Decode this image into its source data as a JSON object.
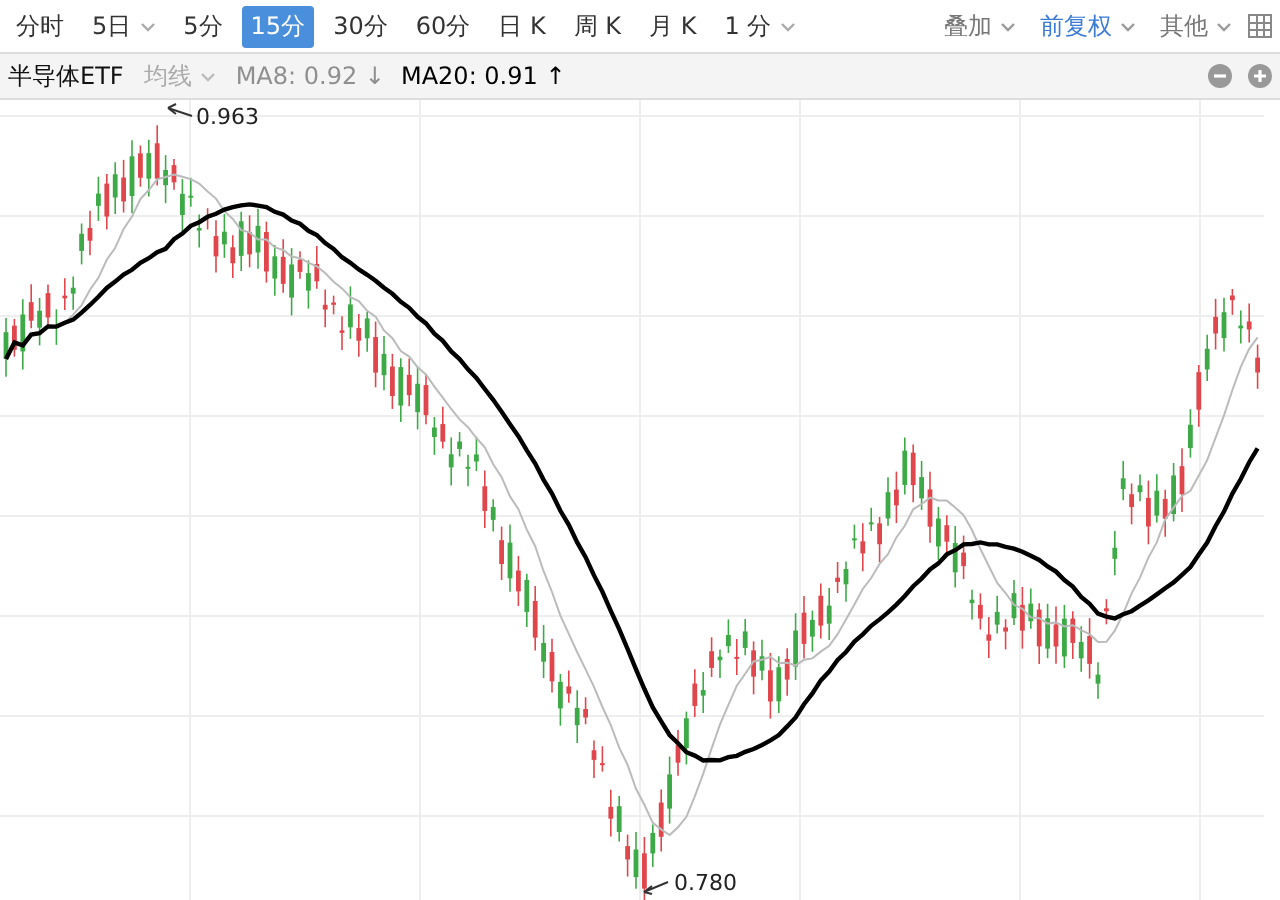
{
  "toolbar": {
    "periods": [
      {
        "label": "分时",
        "selected": false,
        "dropdown": false
      },
      {
        "label": "5日",
        "selected": false,
        "dropdown": true
      },
      {
        "label": "5分",
        "selected": false,
        "dropdown": false
      },
      {
        "label": "15分",
        "selected": true,
        "dropdown": false
      },
      {
        "label": "30分",
        "selected": false,
        "dropdown": false
      },
      {
        "label": "60分",
        "selected": false,
        "dropdown": false
      },
      {
        "label": "日 K",
        "selected": false,
        "dropdown": false
      },
      {
        "label": "周 K",
        "selected": false,
        "dropdown": false
      },
      {
        "label": "月 K",
        "selected": false,
        "dropdown": false
      },
      {
        "label": "1 分",
        "selected": false,
        "dropdown": true
      }
    ],
    "options": [
      {
        "label": "叠加",
        "highlighted": false
      },
      {
        "label": "前复权",
        "highlighted": true
      },
      {
        "label": "其他",
        "highlighted": false
      }
    ]
  },
  "legend": {
    "name": "半导体ETF",
    "ma_menu": "均线",
    "indicators": [
      {
        "label": "MA8: 0.92 ↓",
        "active": false
      },
      {
        "label": "MA20: 0.91 ↑",
        "active": true
      }
    ]
  },
  "chart": {
    "high_label": "0.963",
    "low_label": "0.780"
  }
}
